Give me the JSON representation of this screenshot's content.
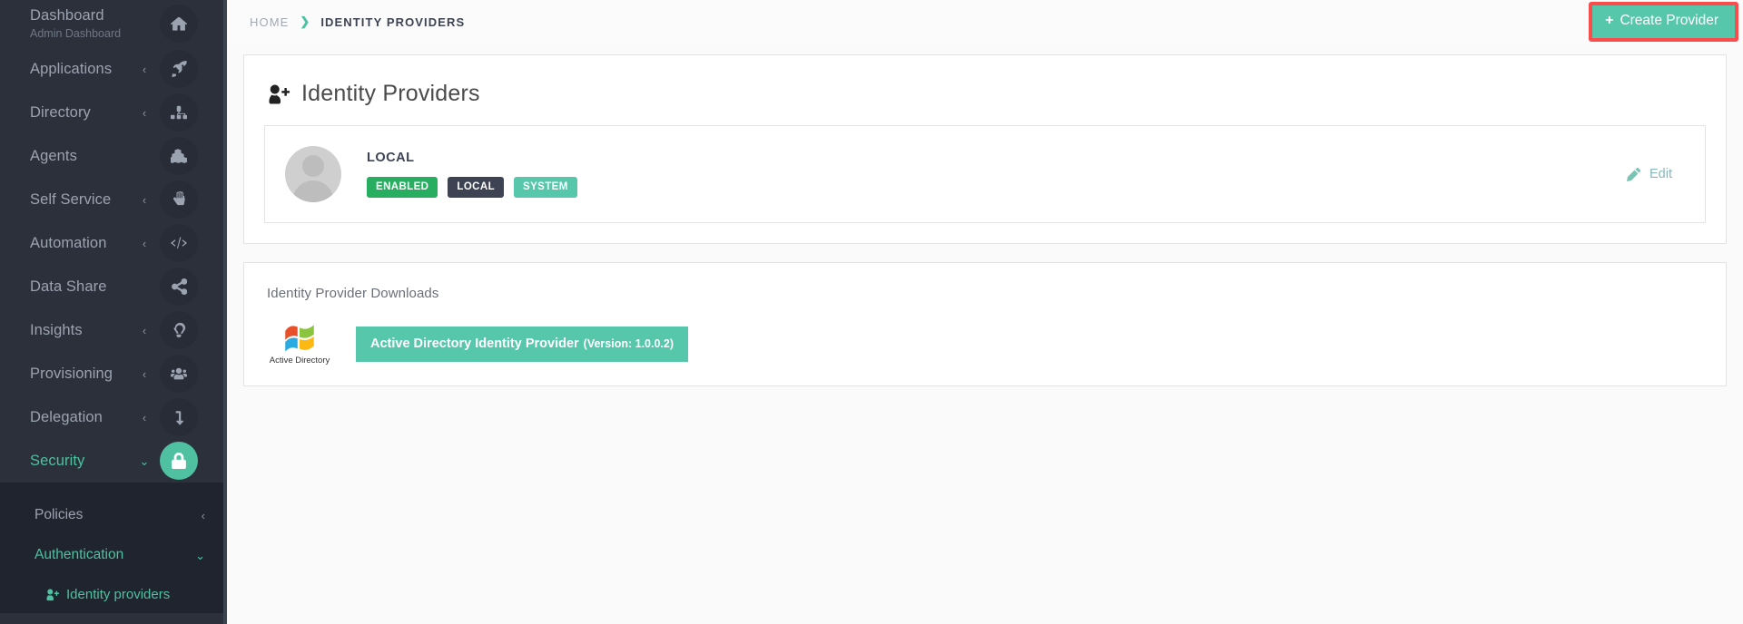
{
  "sidebar": {
    "items": [
      {
        "label": "Dashboard",
        "sublabel": "Admin Dashboard",
        "icon": "home-icon",
        "caret": "",
        "active": false
      },
      {
        "label": "Applications",
        "sublabel": "",
        "icon": "rocket-icon",
        "caret": "‹",
        "active": false
      },
      {
        "label": "Directory",
        "sublabel": "",
        "icon": "sitemap-icon",
        "caret": "‹",
        "active": false
      },
      {
        "label": "Agents",
        "sublabel": "",
        "icon": "cubes-icon",
        "caret": "",
        "active": false
      },
      {
        "label": "Self Service",
        "sublabel": "",
        "icon": "hand-icon",
        "caret": "‹",
        "active": false
      },
      {
        "label": "Automation",
        "sublabel": "",
        "icon": "code-icon",
        "caret": "‹",
        "active": false
      },
      {
        "label": "Data Share",
        "sublabel": "",
        "icon": "share-icon",
        "caret": "",
        "active": false
      },
      {
        "label": "Insights",
        "sublabel": "",
        "icon": "lightbulb-icon",
        "caret": "‹",
        "active": false
      },
      {
        "label": "Provisioning",
        "sublabel": "",
        "icon": "users-icon",
        "caret": "‹",
        "active": false
      },
      {
        "label": "Delegation",
        "sublabel": "",
        "icon": "arrow-turn-icon",
        "caret": "‹",
        "active": false
      },
      {
        "label": "Security",
        "sublabel": "",
        "icon": "lock-icon",
        "caret": "⌄",
        "active": true
      }
    ],
    "submenu": [
      {
        "label": "Policies",
        "caret": "‹",
        "active": false
      },
      {
        "label": "Authentication",
        "caret": "⌄",
        "active": true
      }
    ],
    "submenu_deep": [
      {
        "label": "Identity providers",
        "icon": "user-plus-icon",
        "active": true
      }
    ]
  },
  "topbar": {
    "breadcrumb": {
      "home": "HOME",
      "separator": "❯",
      "current": "IDENTITY PROVIDERS"
    },
    "create_button": {
      "label": "Create Provider",
      "plus": "+"
    },
    "highlight_color": "#fc4b4b",
    "accent_color": "#57c7ab"
  },
  "page": {
    "title": "Identity Providers",
    "title_icon": "user-plus-icon"
  },
  "providers": [
    {
      "name": "LOCAL",
      "avatar": "avatar-placeholder",
      "badges": [
        {
          "text": "ENABLED",
          "color": "#27ae60"
        },
        {
          "text": "LOCAL",
          "color": "#3d4352"
        },
        {
          "text": "SYSTEM",
          "color": "#57c7ab"
        }
      ],
      "edit": {
        "label": "Edit",
        "icon": "pencil-icon"
      }
    }
  ],
  "downloads": {
    "title": "Identity Provider Downloads",
    "items": [
      {
        "logo_icon": "windows-logo-icon",
        "logo_label": "Active Directory",
        "button_label": "Active Directory Identity Provider",
        "button_version": "(Version: 1.0.0.2)"
      }
    ]
  }
}
